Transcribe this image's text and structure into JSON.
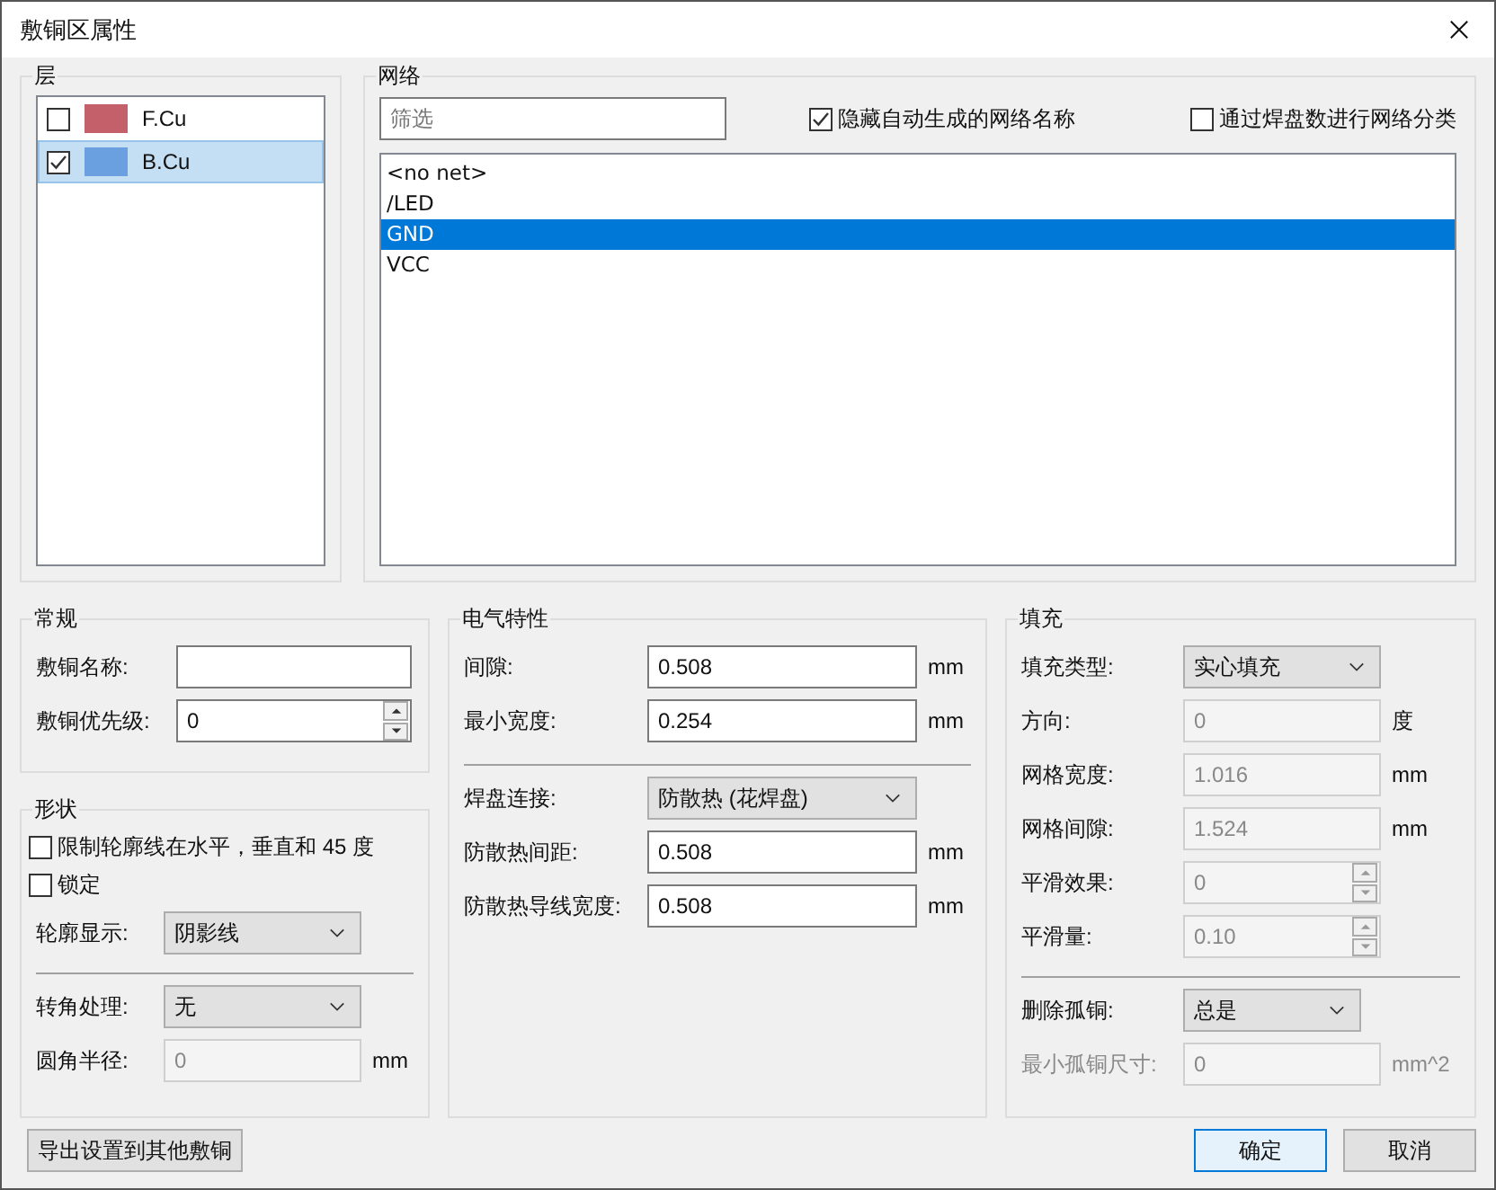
{
  "window": {
    "title": "敷铜区属性"
  },
  "layers": {
    "title": "层",
    "items": [
      {
        "name": "F.Cu",
        "color": "#c4606a",
        "checked": false,
        "selected": false
      },
      {
        "name": "B.Cu",
        "color": "#6a9fe0",
        "checked": true,
        "selected": true
      }
    ]
  },
  "nets": {
    "title": "网络",
    "filter": {
      "placeholder": "筛选"
    },
    "options": [
      {
        "label": "隐藏自动生成的网络名称",
        "checked": true
      },
      {
        "label": "通过焊盘数进行网络分类",
        "checked": false
      }
    ],
    "items": [
      {
        "name": "<no net>",
        "selected": false
      },
      {
        "name": "/LED",
        "selected": false
      },
      {
        "name": "GND",
        "selected": true
      },
      {
        "name": "VCC",
        "selected": false
      }
    ]
  },
  "general": {
    "title": "常规",
    "rows": [
      {
        "kind": "text",
        "label": "敷铜名称:",
        "disabled": false,
        "dimmed": false
      },
      {
        "kind": "spin",
        "label": "敷铜优先级:",
        "value": "0",
        "disabled": false,
        "dimmed": false
      }
    ]
  },
  "shape": {
    "title": "形状",
    "rows": [
      {
        "kind": "checkbox",
        "label": "限制轮廓线在水平，垂直和 45 度",
        "checked": false
      },
      {
        "kind": "checkbox",
        "label": "锁定",
        "checked": false
      },
      {
        "kind": "select",
        "label": "轮廓显示:",
        "value": "阴影线",
        "disabled": false,
        "dimmed": false
      },
      {
        "kind": "divider"
      },
      {
        "kind": "select",
        "label": "转角处理:",
        "value": "无",
        "disabled": false,
        "dimmed": false
      },
      {
        "kind": "text",
        "label": "圆角半径:",
        "value": "0",
        "unit": "mm",
        "disabled": true,
        "dimmed": false
      }
    ]
  },
  "electrical": {
    "title": "电气特性",
    "rows": [
      {
        "kind": "text",
        "label": "间隙:",
        "value": "0.508",
        "unit": "mm",
        "disabled": false,
        "dimmed": false
      },
      {
        "kind": "text",
        "label": "最小宽度:",
        "value": "0.254",
        "unit": "mm",
        "disabled": false,
        "dimmed": false
      },
      {
        "kind": "divider"
      },
      {
        "kind": "select",
        "label": "焊盘连接:",
        "value": "防散热 (花焊盘)",
        "disabled": false,
        "dimmed": false
      },
      {
        "kind": "text",
        "label": "防散热间距:",
        "value": "0.508",
        "unit": "mm",
        "disabled": false,
        "dimmed": false
      },
      {
        "kind": "text",
        "label": "防散热导线宽度:",
        "value": "0.508",
        "unit": "mm",
        "disabled": false,
        "dimmed": false
      }
    ]
  },
  "fill": {
    "title": "填充",
    "rows": [
      {
        "kind": "select",
        "label": "填充类型:",
        "value": "实心填充",
        "disabled": false,
        "dimmed": false
      },
      {
        "kind": "text",
        "label": "方向:",
        "value": "0",
        "unit": "度",
        "disabled": true,
        "dimmed": false
      },
      {
        "kind": "text",
        "label": "网格宽度:",
        "value": "1.016",
        "unit": "mm",
        "disabled": true,
        "dimmed": false
      },
      {
        "kind": "text",
        "label": "网格间隙:",
        "value": "1.524",
        "unit": "mm",
        "disabled": true,
        "dimmed": false
      },
      {
        "kind": "spin",
        "label": "平滑效果:",
        "value": "0",
        "disabled": true,
        "dimmed": false
      },
      {
        "kind": "spin",
        "label": "平滑量:",
        "value": "0.10",
        "disabled": true,
        "dimmed": false
      },
      {
        "kind": "divider"
      },
      {
        "kind": "select",
        "label": "删除孤铜:",
        "value": "总是",
        "disabled": false,
        "dimmed": false
      },
      {
        "kind": "text",
        "label": "最小孤铜尺寸:",
        "value": "0",
        "unit": "mm^2",
        "disabled": true,
        "dimmed": true
      }
    ]
  },
  "footer": {
    "left": [
      {
        "label": "导出设置到其他敷铜",
        "default": false
      }
    ],
    "right": [
      {
        "label": "确定",
        "default": true
      },
      {
        "label": "取消",
        "default": false
      }
    ]
  }
}
